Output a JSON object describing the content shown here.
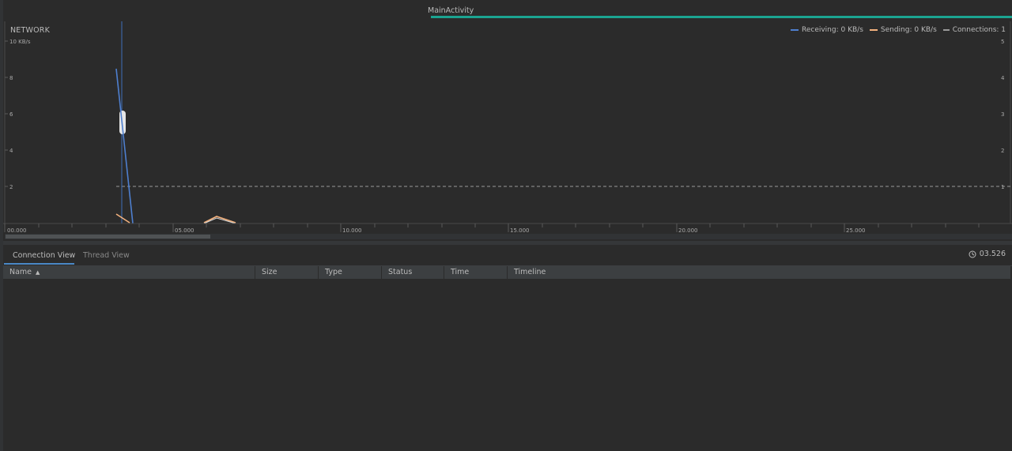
{
  "activity": {
    "label": "MainActivity"
  },
  "network": {
    "title": "NETWORK",
    "legend": {
      "receiving": "Receiving: 0 KB/s",
      "sending": "Sending: 0 KB/s",
      "connections": "Connections: 1"
    },
    "left_axis": [
      "10 KB/s",
      "8",
      "6",
      "4",
      "2"
    ],
    "right_axis": [
      "5",
      "4",
      "3",
      "2",
      "1"
    ],
    "time_axis": [
      "00.000",
      "05.000",
      "10.000",
      "15.000",
      "20.000",
      "25.000"
    ],
    "colors": {
      "receiving": "#4e7fcf",
      "sending": "#f4b27e",
      "connections": "#9a9a9a",
      "activity": "#1ba491"
    }
  },
  "tabs": {
    "connection_view": "Connection View",
    "thread_view": "Thread View"
  },
  "selection_time": "03.526",
  "table": {
    "columns": [
      "Name",
      "Size",
      "Type",
      "Status",
      "Time",
      "Timeline"
    ],
    "sort_icon": "sort-ascending-icon"
  }
}
